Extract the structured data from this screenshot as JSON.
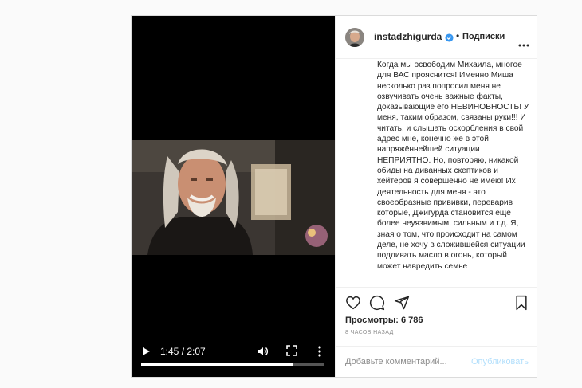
{
  "video": {
    "time_display": "1:45 / 2:07",
    "progress_fraction": 0.826,
    "play_icon": "play-icon",
    "volume_icon": "volume-icon",
    "fullscreen_icon": "fullscreen-icon",
    "more_icon": "more-vertical-icon"
  },
  "header": {
    "username": "instadzhigurda",
    "separator": "•",
    "follow_label": "Подписки",
    "verified_icon": "verified-badge-icon",
    "more_icon": "more-horizontal-icon"
  },
  "caption": {
    "text": "Когда мы освободим Михаила, многое для ВАС прояснится! Именно Миша несколько раз попросил меня не озвучивать очень важные факты, доказывающие его НЕВИНОВНОСТЬ! У меня, таким образом, связаны руки!!! И читать, и слышать оскорбления в свой адрес мне, конечно же в этой напряжённейшей ситуации НЕПРИЯТНО. Но, повторяю, никакой обиды на диванных скептиков и хейтеров я совершенно не имею! Их деятельность для меня - это своеобразные прививки, переварив которые, Джигурда становится ещё более неуязвимым, сильным и т.д. Я, зная о том, что происходит на самом деле, не хочу в сложившейся ситуации подливать масло в огонь, который может навредить семье"
  },
  "actions": {
    "like_icon": "heart-icon",
    "comment_icon": "comment-icon",
    "share_icon": "share-icon",
    "save_icon": "bookmark-icon"
  },
  "stats": {
    "views": "Просмотры: 6 786",
    "timestamp": "8 ЧАСОВ НАЗАД"
  },
  "comment": {
    "placeholder": "Добавьте комментарий...",
    "post_label": "Опубликовать"
  },
  "colors": {
    "video_bg": "#000000",
    "verified_blue": "#3897f0",
    "post_button_disabled": "#b2dffc",
    "text_primary": "#262626",
    "text_secondary": "#8e8e8e",
    "border": "#dbdbdb"
  }
}
